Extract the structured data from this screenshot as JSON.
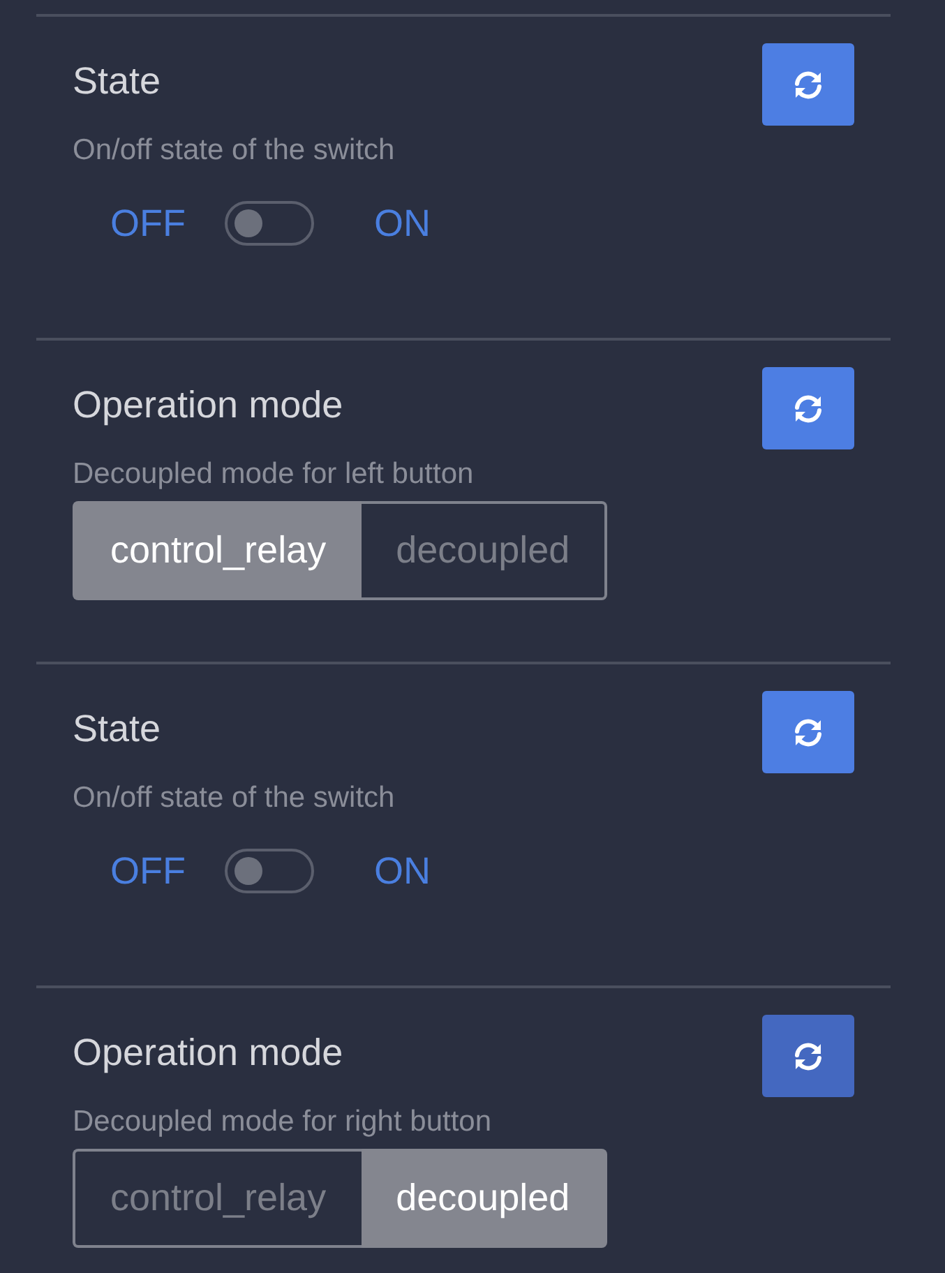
{
  "entities": [
    {
      "kind": "toggle",
      "title": "State",
      "description": "On/off state of the switch",
      "off_label": "OFF",
      "on_label": "ON",
      "on": false,
      "hovered": false
    },
    {
      "kind": "select",
      "title": "Operation mode",
      "description": "Decoupled mode for left button",
      "hovered": false,
      "options": [
        {
          "label": "control_relay",
          "selected": true
        },
        {
          "label": "decoupled",
          "selected": false
        }
      ]
    },
    {
      "kind": "toggle",
      "title": "State",
      "description": "On/off state of the switch",
      "off_label": "OFF",
      "on_label": "ON",
      "on": false,
      "hovered": false
    },
    {
      "kind": "select",
      "title": "Operation mode",
      "description": "Decoupled mode for right button",
      "hovered": true,
      "options": [
        {
          "label": "control_relay",
          "selected": false
        },
        {
          "label": "decoupled",
          "selected": true
        }
      ]
    }
  ]
}
